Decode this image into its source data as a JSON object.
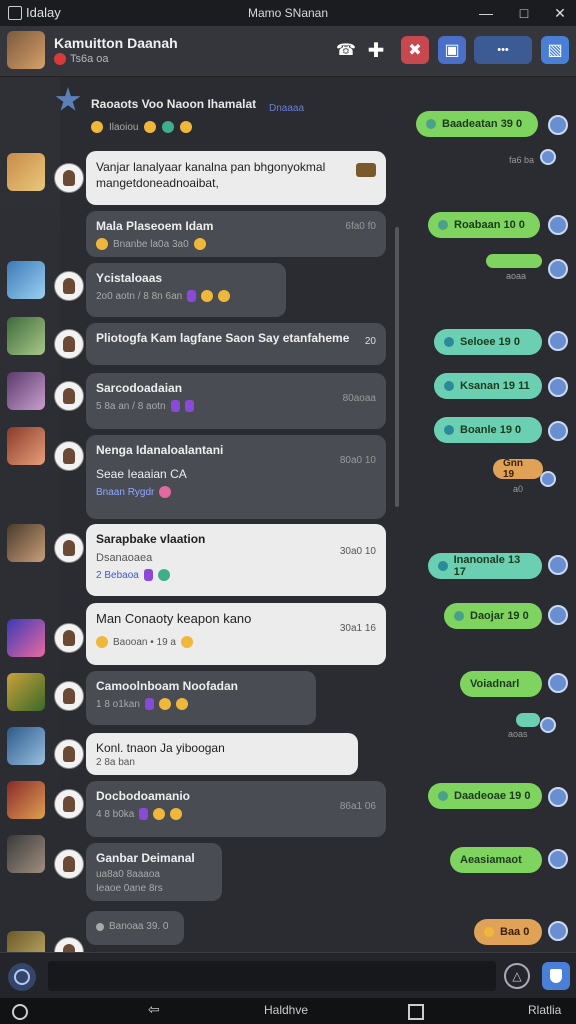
{
  "window": {
    "app_name": "Idalay",
    "title": "Mamo SNanan"
  },
  "header": {
    "name": "Kamuitton Daanah",
    "status": "Ts6a oa"
  },
  "pinned": {
    "title": "Raoaots Voo Naoon Ihamalat",
    "meta": "Ilaoiou",
    "time": "Dnaaaa"
  },
  "incoming": [
    {
      "title": "Vanjar lanalyaar kanalna pan bhgonyokmal mangetdoneadnoaibat,",
      "meta": "",
      "time": ""
    },
    {
      "title": "Mala Plaseoem Idam",
      "meta": "Bnanbe la0a 3a0",
      "time": "6fa0 f0"
    },
    {
      "title": "Ycistaloaas",
      "meta": "2o0 aotn / 8 8n 6an",
      "time": ""
    },
    {
      "title": "Pliotogfa Kam lagfane Saon Say etanfaheme",
      "meta": "",
      "time": "20"
    },
    {
      "title": "Sarcodoadaian",
      "meta": "5 8a an / 8 aotn",
      "time": "80aoaa"
    },
    {
      "title": "Nenga Idanaloalantani",
      "meta": "Bnaan Rygdr",
      "time": "80a0 10",
      "line2": "Seae Ieaaian CA"
    },
    {
      "title": "Sarapbake vlaation",
      "meta": "2 Bebaoa",
      "time": "30a0 10",
      "line2": "Dsanaoaea"
    },
    {
      "title": "Man Conaoty keapon kano",
      "meta": "Baooan • 19 a",
      "time": "30a1 16"
    },
    {
      "title": "Camoolnboam Noofadan",
      "meta": "1 8 o1kan",
      "time": ""
    },
    {
      "title": "Konl. tnaon Ja yiboogan",
      "meta": "2 8a ban",
      "time": ""
    },
    {
      "title": "Docbodoamanio",
      "meta": "4 8 b0ka",
      "time": "86a1 06"
    },
    {
      "title": "Ganbar Deimanal",
      "meta": "Ieaoe 0ane  8rs",
      "time": "",
      "line2": "ua8a0 8aaaoa"
    },
    {
      "title": "",
      "meta": "Banoaa  39. 0",
      "time": ""
    }
  ],
  "outgoing": [
    {
      "label": "Baadeatan 39 0",
      "time": "fa6 ba",
      "color": "green"
    },
    {
      "label": "Roabaan 10 0",
      "time": "",
      "color": "green"
    },
    {
      "label": "",
      "time": "aoaa",
      "color": "green"
    },
    {
      "label": "Seloee 19 0",
      "time": "",
      "color": "teal"
    },
    {
      "label": "Ksanan 19 11",
      "time": "",
      "color": "teal"
    },
    {
      "label": "Boanle 19 0",
      "time": "",
      "color": "teal"
    },
    {
      "label": "Gnn 19",
      "time": "a0",
      "color": "orange"
    },
    {
      "label": "Inanonale 13 17",
      "time": "",
      "color": "teal"
    },
    {
      "label": "Daojar 19 0",
      "time": "",
      "color": "green"
    },
    {
      "label": "Voiadnarl",
      "time": "",
      "color": "green"
    },
    {
      "label": "",
      "time": "aoas",
      "color": "teal"
    },
    {
      "label": "Daadeoae 19 0",
      "time": "",
      "color": "green"
    },
    {
      "label": "Aeasiamaot",
      "time": "",
      "color": "green"
    },
    {
      "label": "Baa 0",
      "time": "",
      "color": "orange"
    }
  ],
  "navbar": {
    "center": "Haldhve",
    "right": "Rlatlia"
  },
  "colors": {
    "green": "#7fd35f",
    "teal": "#6bd0b2",
    "orange": "#e0a257",
    "accent": "#4a7fd8"
  }
}
